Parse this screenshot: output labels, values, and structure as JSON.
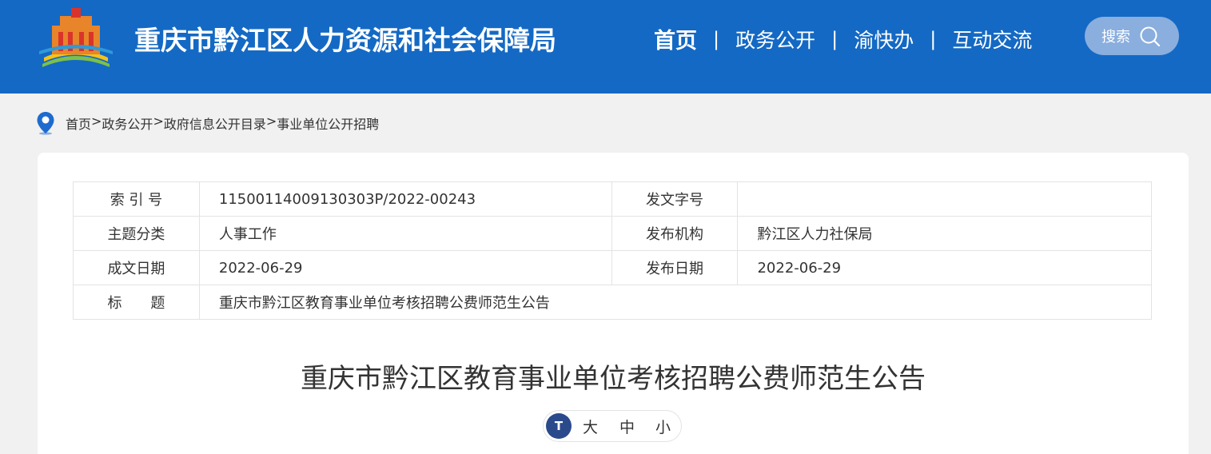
{
  "header": {
    "site_title": "重庆市黔江区人力资源和社会保障局",
    "nav": [
      {
        "label": "首页"
      },
      {
        "label": "政务公开"
      },
      {
        "label": "渝快办"
      },
      {
        "label": "互动交流"
      }
    ],
    "nav_separator": "|",
    "search_label": "搜索"
  },
  "breadcrumb": {
    "items": [
      "首页",
      "政务公开",
      "政府信息公开目录",
      "事业单位公开招聘"
    ],
    "separator": ">"
  },
  "info_table": {
    "index_label": "索 引 号",
    "index_value": "11500114009130303P/2022-00243",
    "doc_no_label": "发文字号",
    "doc_no_value": "",
    "topic_label": "主题分类",
    "topic_value": "人事工作",
    "publisher_label": "发布机构",
    "publisher_value": "黔江区人力社保局",
    "created_label": "成文日期",
    "created_value": "2022-06-29",
    "published_label": "发布日期",
    "published_value": "2022-06-29",
    "title_label": "标　　题",
    "title_value": "重庆市黔江区教育事业单位考核招聘公费师范生公告"
  },
  "article": {
    "title": "重庆市黔江区教育事业单位考核招聘公费师范生公告"
  },
  "font_size": {
    "icon_text": "T",
    "large": "大",
    "medium": "中",
    "small": "小"
  },
  "colors": {
    "header_bg": "#1469c4",
    "search_bg": "#8aaede",
    "page_bg": "#f1f1f1"
  }
}
